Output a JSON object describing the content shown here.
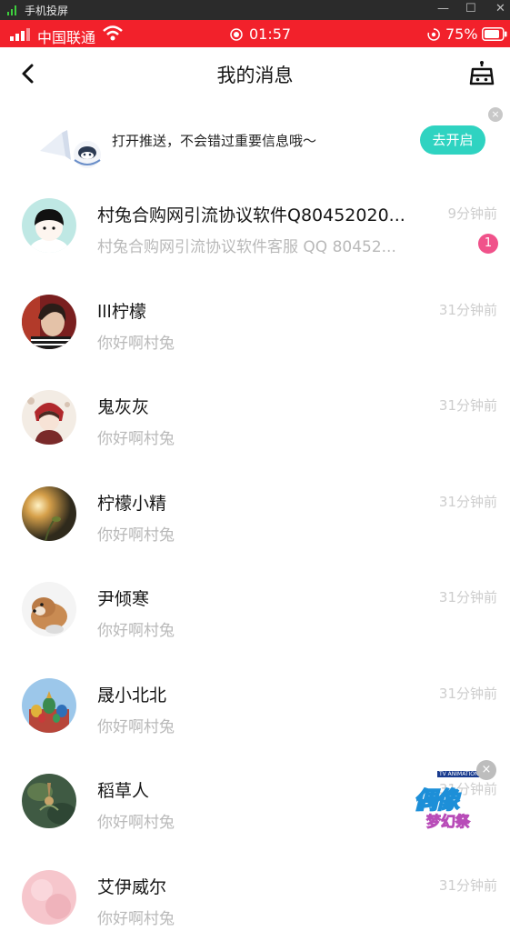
{
  "host_window": {
    "title": "手机投屏",
    "min": "—",
    "max": "☐",
    "close": "✕"
  },
  "status_bar": {
    "carrier": "中国联通",
    "time": "01:57",
    "battery": "75%"
  },
  "header": {
    "title": "我的消息"
  },
  "push_banner": {
    "text": "打开推送，不会错过重要信息哦～",
    "button": "去开启",
    "close": "×"
  },
  "messages": [
    {
      "name": "村兔合购网引流协议软件Q80452020...",
      "preview": "村兔合购网引流协议软件客服 QQ 80452...",
      "time": "9分钟前",
      "badge": "1"
    },
    {
      "name": "lll柠檬",
      "preview": "你好啊村兔",
      "time": "31分钟前"
    },
    {
      "name": "鬼灰灰",
      "preview": "你好啊村兔",
      "time": "31分钟前"
    },
    {
      "name": "柠檬小精",
      "preview": "你好啊村兔",
      "time": "31分钟前"
    },
    {
      "name": "尹倾寒",
      "preview": "你好啊村兔",
      "time": "31分钟前"
    },
    {
      "name": "晟小北北",
      "preview": "你好啊村兔",
      "time": "31分钟前"
    },
    {
      "name": "稻草人",
      "preview": "你好啊村兔",
      "time": "31分钟前"
    },
    {
      "name": "艾伊威尔",
      "preview": "你好啊村兔",
      "time": "31分钟前"
    }
  ],
  "floating_ad": {
    "top_label": "TV ANIMATION",
    "title": "偶像",
    "subtitle": "梦幻祭",
    "close": "×"
  },
  "icons": {
    "back": "back-arrow-icon",
    "robot": "robot-icon",
    "wifi": "wifi-icon",
    "signal": "signal-icon",
    "battery": "battery-icon"
  },
  "colors": {
    "status_bar": "#f2212b",
    "accent_button": "#2fd3c1",
    "badge": "#f0528a"
  }
}
